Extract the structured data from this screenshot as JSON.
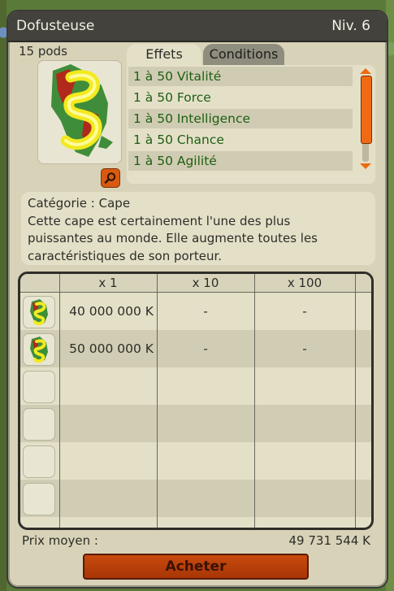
{
  "window": {
    "title": "Dofusteuse",
    "level": "Niv. 6"
  },
  "item": {
    "weight": "15 pods",
    "image_icon": "dofusteuse-cape-icon",
    "zoom_icon": "magnifier-icon"
  },
  "tabs": [
    {
      "label": "Effets",
      "active": true
    },
    {
      "label": "Conditions",
      "active": false
    }
  ],
  "effects": [
    "1 à 50 Vitalité",
    "1 à 50 Force",
    "1 à 50 Intelligence",
    "1 à 50 Chance",
    "1 à 50 Agilité"
  ],
  "description": {
    "category": "Catégorie : Cape",
    "lines": [
      "Cette cape est certainement l'une des plus",
      "puissantes au monde. Elle augmente toutes les",
      "caractéristiques de son porteur."
    ]
  },
  "price_table": {
    "headers": [
      "x 1",
      "x 10",
      "x 100"
    ],
    "rows": [
      {
        "x1": "40 000 000 K",
        "x10": "-",
        "x100": "-"
      },
      {
        "x1": "50 000 000 K",
        "x10": "-",
        "x100": "-"
      }
    ]
  },
  "average": {
    "label": "Prix moyen :",
    "value": "49 731 544 K"
  },
  "buy_button": {
    "label": "Acheter"
  },
  "colors": {
    "title_bar": "#43423c",
    "panel": "#e4e0c8",
    "effect_text": "#1f5e12",
    "accent_orange": "#f06a14",
    "buy_button": "#c84a0e"
  }
}
